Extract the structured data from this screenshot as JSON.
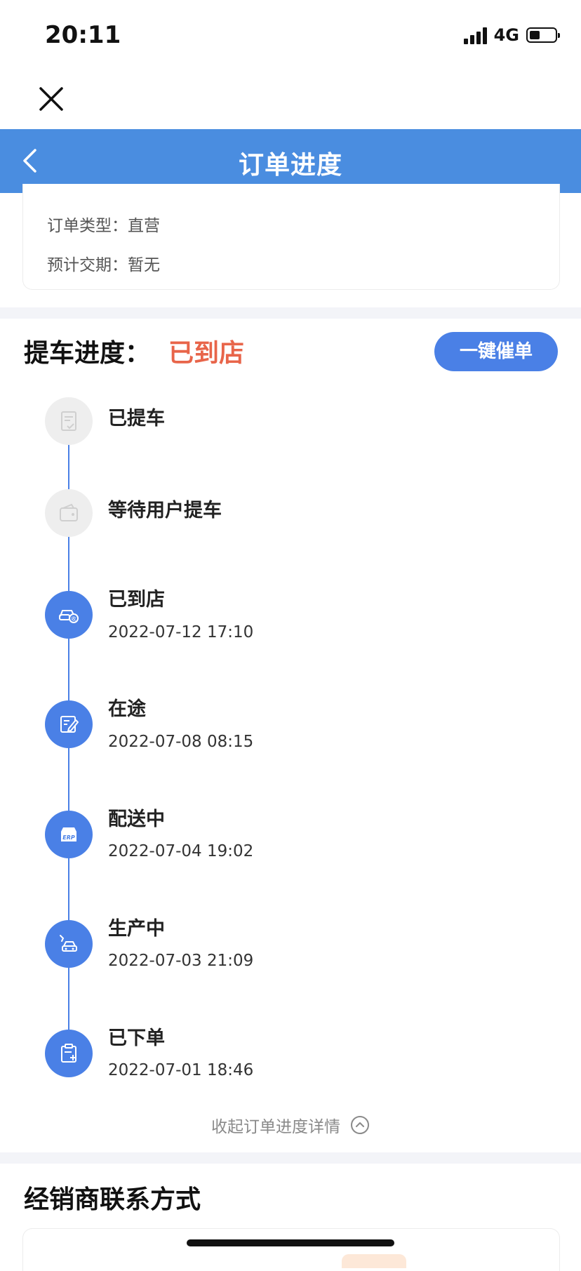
{
  "status_bar": {
    "time": "20:11",
    "network": "4G"
  },
  "nav": {
    "title": "订单进度"
  },
  "order_info": {
    "type_label": "订单类型：",
    "type_value": "直营",
    "delivery_label": "预计交期：",
    "delivery_value": "暂无"
  },
  "progress": {
    "label": "提车进度：",
    "status": "已到店",
    "urge_button": "一键催单",
    "steps": [
      {
        "title": "已提车",
        "time": "",
        "state": "pending",
        "icon": "document-check-icon"
      },
      {
        "title": "等待用户提车",
        "time": "",
        "state": "pending",
        "icon": "wallet-icon"
      },
      {
        "title": "已到店",
        "time": "2022-07-12 17:10",
        "state": "done",
        "icon": "car-received-icon"
      },
      {
        "title": "在途",
        "time": "2022-07-08 08:15",
        "state": "done",
        "icon": "edit-document-icon"
      },
      {
        "title": "配送中",
        "time": "2022-07-04 19:02",
        "state": "done",
        "icon": "erp-box-icon"
      },
      {
        "title": "生产中",
        "time": "2022-07-03 21:09",
        "state": "done",
        "icon": "car-production-icon"
      },
      {
        "title": "已下单",
        "time": "2022-07-01 18:46",
        "state": "done",
        "icon": "clipboard-add-icon"
      }
    ],
    "collapse_text": "收起订单进度详情"
  },
  "dealer": {
    "title": "经销商联系方式"
  },
  "colors": {
    "primary": "#4a80e6",
    "nav": "#4a8de0",
    "status": "#e8654a"
  }
}
